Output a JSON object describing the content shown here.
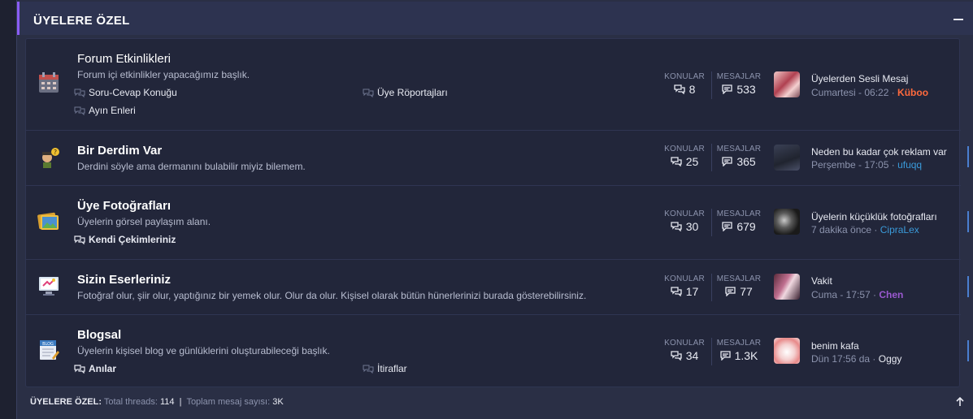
{
  "header": {
    "title": "ÜYELERE ÖZEL"
  },
  "stats_labels": {
    "threads": "KONULAR",
    "messages": "MESAJLAR"
  },
  "nodes": [
    {
      "title": "Forum Etkinlikleri",
      "desc": "Forum içi etkinlikler yapacağımız başlık.",
      "subforums": [
        "Soru-Cevap Konuğu",
        "Üye Röportajları",
        "Ayın Enleri"
      ],
      "threads": "8",
      "messages": "533",
      "last_title": "Üyelerden Sesli Mesaj",
      "last_time": "Cumartesi - 06:22",
      "last_user": "Küboo",
      "last_user_color": "#ff6a3d"
    },
    {
      "title": "Bir Derdim Var",
      "desc": "Derdini söyle ama dermanını bulabilir miyiz bilemem.",
      "subforums": [],
      "threads": "25",
      "messages": "365",
      "last_title": "Neden bu kadar çok reklam var",
      "last_time": "Perşembe - 17:05",
      "last_user": "ufuqq",
      "last_user_color": "#3a9ad9"
    },
    {
      "title": "Üye Fotoğrafları",
      "desc": "Üyelerin görsel paylaşım alanı.",
      "subforums": [
        "Kendi Çekimleriniz"
      ],
      "threads": "30",
      "messages": "679",
      "last_title": "Üyelerin küçüklük fotoğrafları",
      "last_time": "7 dakika önce",
      "last_user": "CipraLex",
      "last_user_color": "#3a9ad9"
    },
    {
      "title": "Sizin Eserleriniz",
      "desc": "Fotoğraf olur, şiir olur, yaptığınız bir yemek olur. Olur da olur. Kişisel olarak bütün hünerlerinizi burada gösterebilirsiniz.",
      "subforums": [],
      "threads": "17",
      "messages": "77",
      "last_title": "Vakit",
      "last_time": "Cuma - 17:57",
      "last_user": "Chen",
      "last_user_color": "#9b59d0"
    },
    {
      "title": "Blogsal",
      "desc": "Üyelerin kişisel blog ve günlüklerini oluşturabileceği başlık.",
      "subforums": [
        "Anılar",
        "İtiraflar"
      ],
      "threads": "34",
      "messages": "1.3K",
      "last_title": "benim kafa",
      "last_time": "Dün 17:56 da",
      "last_user": "Oggy",
      "last_user_color": "#e8eaf2"
    }
  ],
  "footer": {
    "label": "ÜYELERE ÖZEL:",
    "threads_label": "Total threads:",
    "threads": "114",
    "sep": "|",
    "messages_label": "Toplam mesaj sayısı:",
    "messages": "3K"
  }
}
